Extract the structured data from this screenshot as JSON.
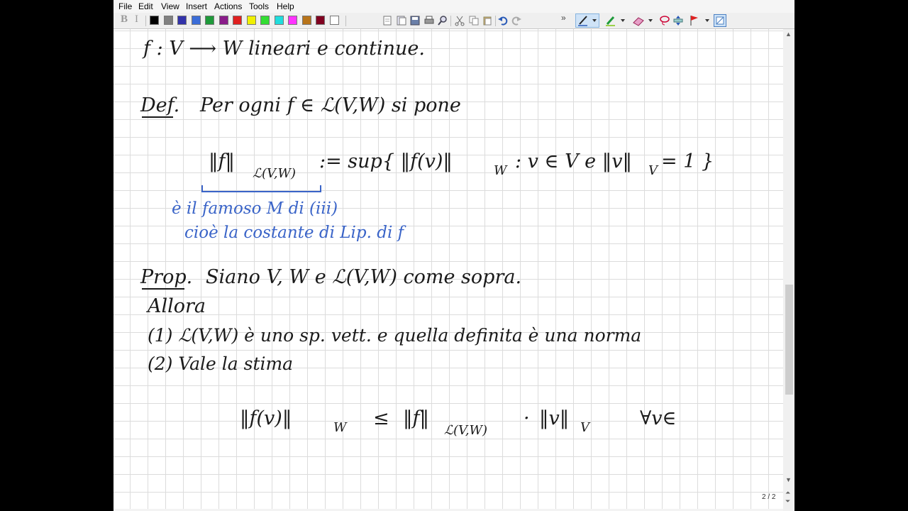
{
  "menu": [
    "File",
    "Edit",
    "View",
    "Insert",
    "Actions",
    "Tools",
    "Help"
  ],
  "toolbar": {
    "bold": "B",
    "italic": "I",
    "colors": [
      "#000000",
      "#808080",
      "#3333aa",
      "#3b6dd8",
      "#1e9a3a",
      "#8a1c8a",
      "#e02020",
      "#f0f000",
      "#33dd33",
      "#20dddd",
      "#ff33ff",
      "#b8741a",
      "#800020",
      "#ffffff"
    ],
    "overflow": "»",
    "icons": [
      "new-page-icon",
      "open-icon",
      "save-icon",
      "print-icon",
      "zoom-icon",
      "cut-icon",
      "copy-icon",
      "paste-icon",
      "undo-icon",
      "redo-icon",
      "pen-icon",
      "highlighter-icon",
      "eraser-icon",
      "lasso-icon",
      "insert-space-icon",
      "flag-icon",
      "fullscreen-icon"
    ]
  },
  "notes": {
    "line1": "f : V ⟶ W lineari e continue.",
    "def_label": "Def.",
    "def_text": "Per ogni f ∈ ℒ(V,W) si pone",
    "norm_lhs": "‖f‖",
    "norm_lhs_sub": "ℒ(V,W)",
    "norm_def": ":= sup{ ‖f(v)‖",
    "norm_def_sub": "W",
    "norm_def_rest": ": v ∈ V e ‖v‖",
    "norm_def_rest_sub": "V",
    "norm_def_end": "= 1 }",
    "annot1": "è il famoso M di (iii)",
    "annot2": "cioè la costante di Lip. di f",
    "prop_label": "Prop.",
    "prop_text": "Siano V, W e ℒ(V,W) come sopra.",
    "allora": "Allora",
    "item1": "(1) ℒ(V,W) è uno sp. vett. e quella definita è una norma",
    "item2": "(2) Vale la stima",
    "ineq_lhs": "‖f(v)‖",
    "ineq_lhs_sub": "W",
    "ineq_leq": "≤",
    "ineq_rhs": "‖f‖",
    "ineq_rhs_sub": "ℒ(V,W)",
    "ineq_dot": "·",
    "ineq_v": "‖v‖",
    "ineq_v_sub": "V",
    "ineq_forall": "∀v∈"
  },
  "page_indicator": "2 / 2",
  "ink": {
    "black": "#1a1a1a",
    "blue": "#3a64c8"
  }
}
